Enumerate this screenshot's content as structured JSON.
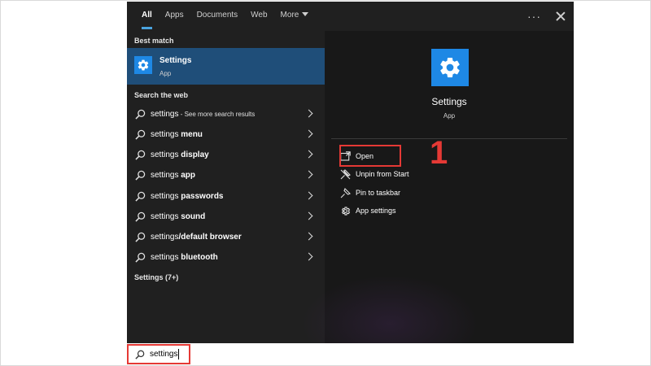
{
  "tabs": {
    "all": "All",
    "apps": "Apps",
    "documents": "Documents",
    "web": "Web",
    "more": "More"
  },
  "left": {
    "best_match_heading": "Best match",
    "best_match": {
      "name": "Settings",
      "type": "App"
    },
    "search_web_heading": "Search the web",
    "web_results": [
      {
        "prefix": "settings",
        "bold": "",
        "suffix": " - See more search results"
      },
      {
        "prefix": "settings ",
        "bold": "menu",
        "suffix": ""
      },
      {
        "prefix": "settings ",
        "bold": "display",
        "suffix": ""
      },
      {
        "prefix": "settings ",
        "bold": "app",
        "suffix": ""
      },
      {
        "prefix": "settings ",
        "bold": "passwords",
        "suffix": ""
      },
      {
        "prefix": "settings ",
        "bold": "sound",
        "suffix": ""
      },
      {
        "prefix": "settings",
        "bold": "/default browser",
        "suffix": ""
      },
      {
        "prefix": "settings ",
        "bold": "bluetooth",
        "suffix": ""
      }
    ],
    "more_results": "Settings (7+)"
  },
  "right": {
    "app_name": "Settings",
    "app_type": "App",
    "actions": {
      "open": "Open",
      "unpin": "Unpin from Start",
      "pin_taskbar": "Pin to taskbar",
      "app_settings": "App settings"
    }
  },
  "annotation": {
    "step_number": "1"
  },
  "search_box": {
    "value": "settings"
  },
  "colors": {
    "panel_bg": "#202020",
    "selected_bg": "#1f4e79",
    "accent": "#1e88e5",
    "annotation": "#e53935"
  }
}
